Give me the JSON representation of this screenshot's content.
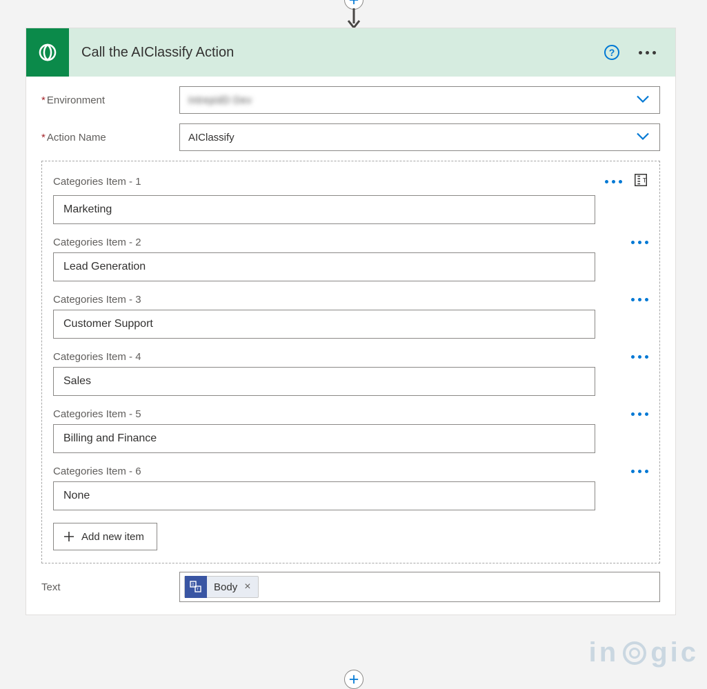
{
  "header": {
    "title": "Call the AIClassify Action"
  },
  "fields": {
    "environment": {
      "label": "Environment",
      "value": "IntrepidD Dev"
    },
    "action_name": {
      "label": "Action Name",
      "value": "AIClassify"
    },
    "text": {
      "label": "Text",
      "pill_label": "Body"
    }
  },
  "categories": {
    "label_prefix": "Categories Item - ",
    "items": [
      {
        "index": "1",
        "value": "Marketing"
      },
      {
        "index": "2",
        "value": "Lead Generation"
      },
      {
        "index": "3",
        "value": "Customer Support"
      },
      {
        "index": "4",
        "value": "Sales"
      },
      {
        "index": "5",
        "value": "Billing and Finance"
      },
      {
        "index": "6",
        "value": "None"
      }
    ],
    "add_button": "Add new item"
  },
  "watermark": {
    "pre": "in",
    "post": "gic"
  }
}
